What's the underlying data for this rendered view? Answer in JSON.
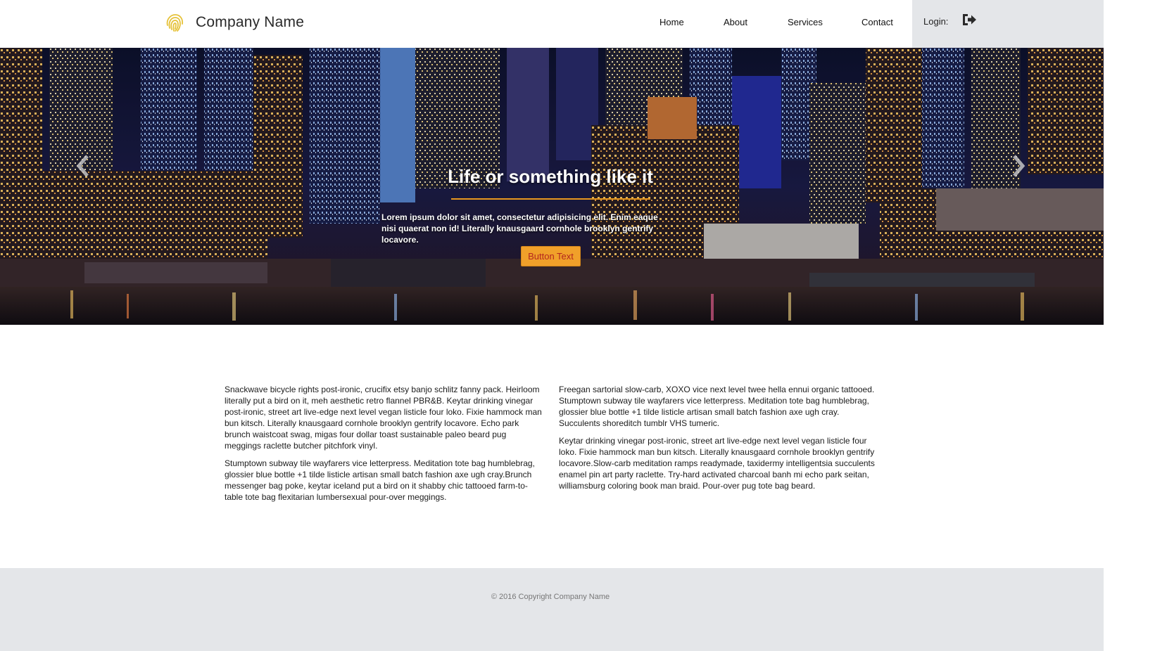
{
  "header": {
    "brand_name": "Company Name",
    "logo_icon": "fingerprint-icon",
    "nav": [
      {
        "label": "Home"
      },
      {
        "label": "About"
      },
      {
        "label": "Services"
      },
      {
        "label": "Contact"
      }
    ],
    "login_label": "Login:",
    "login_icon": "sign-in-icon"
  },
  "hero": {
    "title": "Life or something like it",
    "text": "Lorem ipsum dolor sit amet, consectetur adipisicing elit. Enim eaque nisi quaerat non id! Literally knausgaard cornhole brooklyn gentrify locavore.",
    "button_label": "Button Text",
    "prev_icon": "chevron-left-icon",
    "next_icon": "chevron-right-icon"
  },
  "content": {
    "left": [
      "Snackwave bicycle rights post-ironic, crucifix etsy banjo schlitz fanny pack. Heirloom literally put a bird on it, meh aesthetic retro flannel PBR&B. Keytar drinking vinegar post-ironic, street art live-edge next level vegan listicle four loko. Fixie hammock man bun kitsch. Literally knausgaard cornhole brooklyn gentrify locavore. Echo park brunch waistcoat swag, migas four dollar toast sustainable paleo beard pug meggings raclette butcher pitchfork vinyl.",
      "Stumptown subway tile wayfarers vice letterpress. Meditation tote bag humblebrag, glossier blue bottle +1 tilde listicle artisan small batch fashion axe ugh cray.Brunch messenger bag poke, keytar iceland put a bird on it shabby chic tattooed farm-to-table tote bag flexitarian lumbersexual pour-over meggings."
    ],
    "right": [
      "Freegan sartorial slow-carb, XOXO vice next level twee hella ennui organic tattooed. Stumptown subway tile wayfarers vice letterpress. Meditation tote bag humblebrag, glossier blue bottle +1 tilde listicle artisan small batch fashion axe ugh cray. Succulents shoreditch tumblr VHS tumeric.",
      "Keytar drinking vinegar post-ironic, street art live-edge next level vegan listicle four loko. Fixie hammock man bun kitsch. Literally knausgaard cornhole brooklyn gentrify locavore.Slow-carb meditation ramps readymade, taxidermy intelligentsia succulents enamel pin art party raclette. Try-hard activated charcoal banh mi echo park seitan, williamsburg coloring book man braid. Pour-over pug tote bag beard."
    ]
  },
  "footer": {
    "copyright": "© 2016 Copyright Company Name"
  },
  "colors": {
    "accent": "#f0a02a",
    "accent_rule": "#e8981f",
    "panel_gray": "#e4e6e9",
    "logo_yellow": "#e6c23a"
  }
}
